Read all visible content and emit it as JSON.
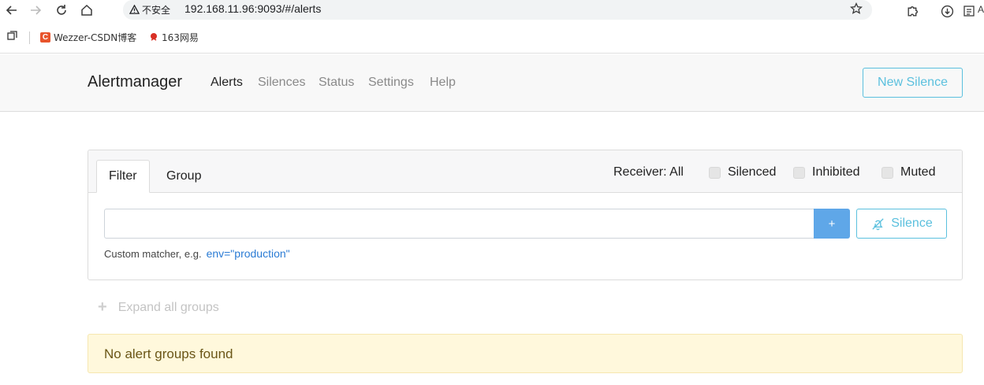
{
  "browser": {
    "security_label": "不安全",
    "url": "192.168.11.96:9093/#/alerts",
    "extension_text": "A",
    "bookmarks": [
      {
        "label": "Wezzer-CSDN博客",
        "icon_text": "C"
      },
      {
        "label": "163网易"
      }
    ]
  },
  "navbar": {
    "brand": "Alertmanager",
    "links": [
      {
        "label": "Alerts",
        "active": true
      },
      {
        "label": "Silences"
      },
      {
        "label": "Status"
      },
      {
        "label": "Settings"
      },
      {
        "label": "Help"
      }
    ],
    "new_silence_label": "New Silence"
  },
  "filter_card": {
    "tabs": [
      {
        "label": "Filter",
        "active": true
      },
      {
        "label": "Group"
      }
    ],
    "receiver_label": "Receiver: All",
    "checkboxes": [
      {
        "label": "Silenced",
        "checked": false
      },
      {
        "label": "Inhibited",
        "checked": false
      },
      {
        "label": "Muted",
        "checked": false
      }
    ],
    "input_value": "",
    "plus_label": "+",
    "silence_label": "Silence",
    "hint_text": "Custom matcher, e.g.",
    "hint_example": "env=\"production\""
  },
  "expand_label": "Expand all groups",
  "alert_message": "No alert groups found",
  "colors": {
    "info": "#5bc0de",
    "primary_button": "#5fa7e8",
    "warning_bg": "#fff8dc",
    "warning_text": "#6a5617"
  }
}
